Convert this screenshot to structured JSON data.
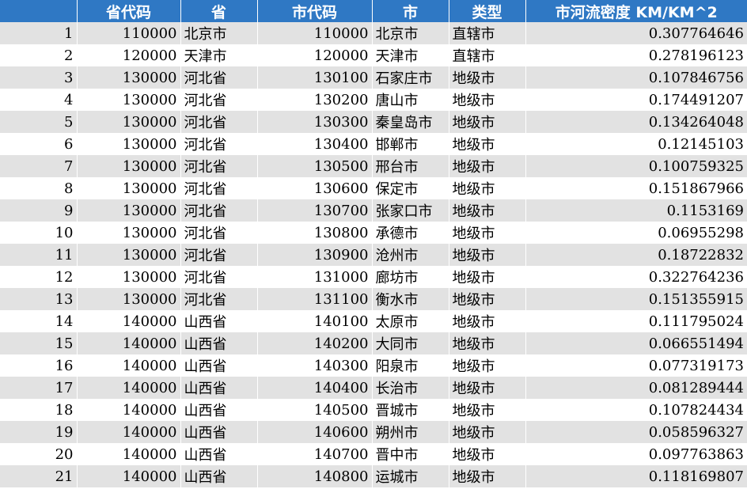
{
  "table": {
    "headers": [
      "",
      "省代码",
      "省",
      "市代码",
      "市",
      "类型",
      "市河流密度 KM/KM^2"
    ],
    "rows": [
      [
        "1",
        "110000",
        "北京市",
        "110000",
        "北京市",
        "直辖市",
        "0.307764646"
      ],
      [
        "2",
        "120000",
        "天津市",
        "120000",
        "天津市",
        "直辖市",
        "0.278196123"
      ],
      [
        "3",
        "130000",
        "河北省",
        "130100",
        "石家庄市",
        "地级市",
        "0.107846756"
      ],
      [
        "4",
        "130000",
        "河北省",
        "130200",
        "唐山市",
        "地级市",
        "0.174491207"
      ],
      [
        "5",
        "130000",
        "河北省",
        "130300",
        "秦皇岛市",
        "地级市",
        "0.134264048"
      ],
      [
        "6",
        "130000",
        "河北省",
        "130400",
        "邯郸市",
        "地级市",
        "0.12145103"
      ],
      [
        "7",
        "130000",
        "河北省",
        "130500",
        "邢台市",
        "地级市",
        "0.100759325"
      ],
      [
        "8",
        "130000",
        "河北省",
        "130600",
        "保定市",
        "地级市",
        "0.151867966"
      ],
      [
        "9",
        "130000",
        "河北省",
        "130700",
        "张家口市",
        "地级市",
        "0.1153169"
      ],
      [
        "10",
        "130000",
        "河北省",
        "130800",
        "承德市",
        "地级市",
        "0.06955298"
      ],
      [
        "11",
        "130000",
        "河北省",
        "130900",
        "沧州市",
        "地级市",
        "0.18722832"
      ],
      [
        "12",
        "130000",
        "河北省",
        "131000",
        "廊坊市",
        "地级市",
        "0.322764236"
      ],
      [
        "13",
        "130000",
        "河北省",
        "131100",
        "衡水市",
        "地级市",
        "0.151355915"
      ],
      [
        "14",
        "140000",
        "山西省",
        "140100",
        "太原市",
        "地级市",
        "0.111795024"
      ],
      [
        "15",
        "140000",
        "山西省",
        "140200",
        "大同市",
        "地级市",
        "0.066551494"
      ],
      [
        "16",
        "140000",
        "山西省",
        "140300",
        "阳泉市",
        "地级市",
        "0.077319173"
      ],
      [
        "17",
        "140000",
        "山西省",
        "140400",
        "长治市",
        "地级市",
        "0.081289444"
      ],
      [
        "18",
        "140000",
        "山西省",
        "140500",
        "晋城市",
        "地级市",
        "0.107824434"
      ],
      [
        "19",
        "140000",
        "山西省",
        "140600",
        "朔州市",
        "地级市",
        "0.058596327"
      ],
      [
        "20",
        "140000",
        "山西省",
        "140700",
        "晋中市",
        "地级市",
        "0.097763863"
      ],
      [
        "21",
        "140000",
        "山西省",
        "140800",
        "运城市",
        "地级市",
        "0.118169807"
      ]
    ]
  },
  "colors": {
    "header_bg": "#2f78c4",
    "header_text": "#ffffff",
    "stripe_row": "#e2e2e2",
    "plain_row": "#ffffff"
  }
}
